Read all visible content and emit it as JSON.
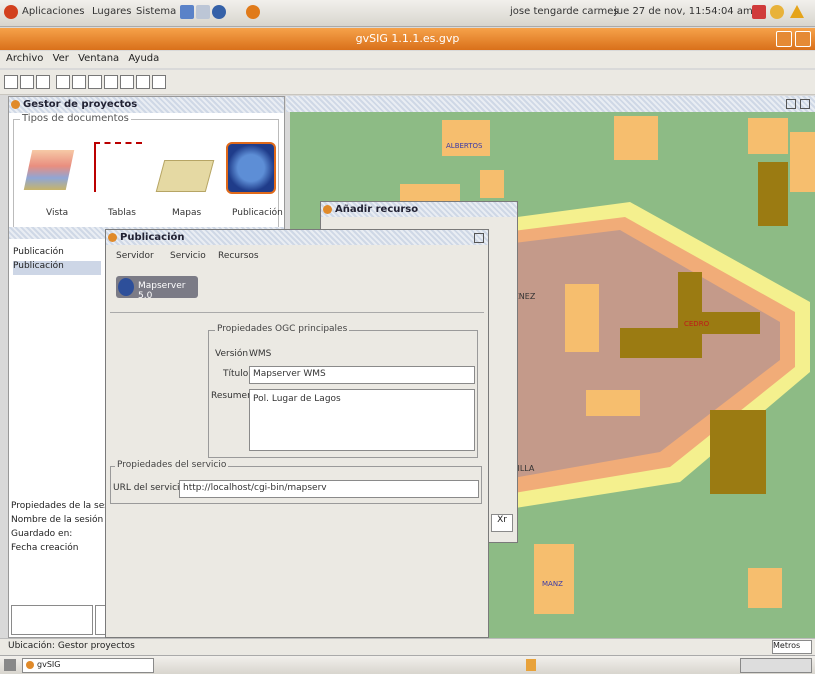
{
  "top_panel": {
    "menus": [
      "Aplicaciones",
      "Lugares",
      "Sistema"
    ],
    "user": "jose tengarde carmes",
    "clock": "jue 27 de nov, 11:54:04 am"
  },
  "window": {
    "title": "gvSIG 1.1.1.es.gvp"
  },
  "menubar": [
    "Archivo",
    "Ver",
    "Ventana",
    "Ayuda"
  ],
  "project_manager": {
    "title": "Gestor de proyectos",
    "doc_types_legend": "Tipos de documentos",
    "doc_types": [
      "Vista",
      "Tablas",
      "Mapas",
      "Publicación"
    ],
    "list_items": [
      "Publicación",
      "Publicación"
    ],
    "props_title": "Propiedades de la ses",
    "props": [
      "Nombre de la sesión",
      "Guardado en:",
      "Fecha creación"
    ]
  },
  "add_resource": {
    "title": "Añadir recurso",
    "cancel_label": "Xr"
  },
  "publish_dialog": {
    "title": "Publicación",
    "tabs": [
      "Servidor",
      "Servicio",
      "Recursos"
    ],
    "server_badge": "Mapserver 5.0",
    "ogc_legend": "Propiedades OGC principales",
    "version_label": "Versión",
    "version_value": "WMS",
    "title_label": "Título",
    "title_value": "Mapserver WMS",
    "abstract_label": "Resumen",
    "abstract_value": "Pol. Lugar de Lagos",
    "service_legend": "Propiedades del servicio",
    "url_label": "URL del servicio",
    "url_value": "http://localhost/cgi-bin/mapserv"
  },
  "map_labels": [
    "ALBERTOS",
    "CEDRO",
    "CUZNEZ",
    "VILLA",
    "MANZ"
  ],
  "status": {
    "left": "Ubicación: Gestor proyectos",
    "right": "Metros"
  },
  "taskbar": {
    "task": "gvSIG"
  }
}
